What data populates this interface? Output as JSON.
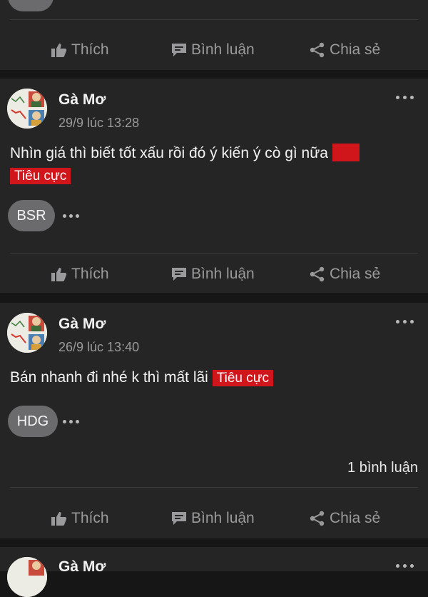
{
  "action_bar": {
    "like_label": "Thích",
    "comment_label": "Bình luận",
    "share_label": "Chia sẻ"
  },
  "posts": [
    {
      "author": "Gà Mơ",
      "timestamp": "29/9 lúc 13:28",
      "text": "Nhìn giá thì biết tốt xấu rồi đó ý kiến ý cò gì nữa",
      "sentiment_tag": "Tiêu cực",
      "stock_tag": "BSR"
    },
    {
      "author": "Gà Mơ",
      "timestamp": "26/9 lúc 13:40",
      "text": "Bán nhanh đi nhé k thì mất lãi",
      "sentiment_tag": "Tiêu cực",
      "stock_tag": "HDG",
      "comment_count": "1 bình luận"
    },
    {
      "author": "Gà Mơ"
    }
  ],
  "colors": {
    "background": "#161617",
    "card": "#252526",
    "sentiment_negative": "#d0161a",
    "muted_text": "#9a9a9c",
    "pill": "#6b6b6d"
  },
  "icons": {
    "like": "thumbs-up-icon",
    "comment": "comment-bubble-icon",
    "share": "share-icon",
    "more": "more-dots-icon"
  }
}
